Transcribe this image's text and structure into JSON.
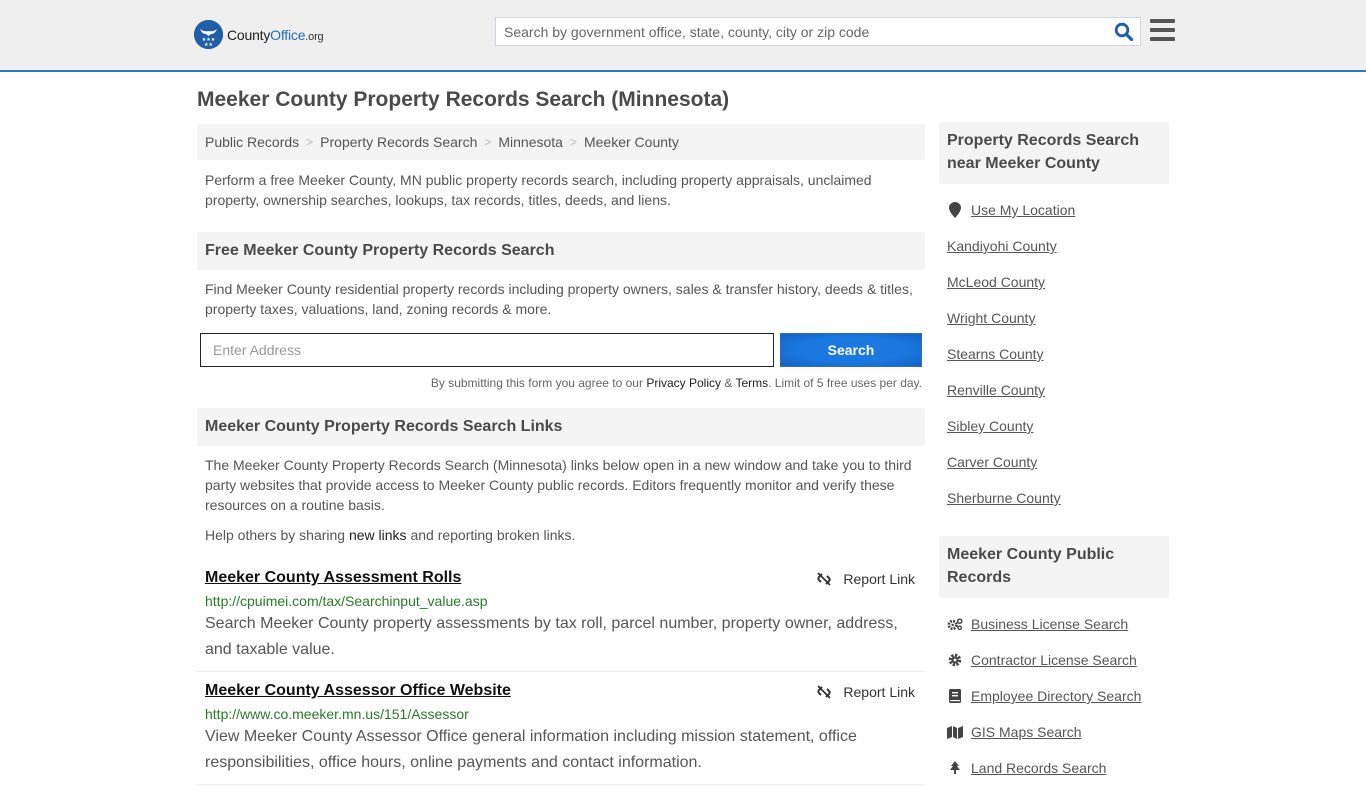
{
  "header": {
    "logo": {
      "name_part1": "County",
      "name_part2": "Office",
      "tld": ".org"
    },
    "search_placeholder": "Search by government office, state, county, city or zip code",
    "search_icon": "search-icon",
    "menu_icon": "hamburger-menu-icon",
    "accent_color": "#3079b5"
  },
  "page": {
    "title": "Meeker County Property Records Search (Minnesota)",
    "breadcrumb": [
      "Public Records",
      "Property Records Search",
      "Minnesota",
      "Meeker County"
    ],
    "intro": "Perform a free Meeker County, MN public property records search, including property appraisals, unclaimed property, ownership searches, lookups, tax records, titles, deeds, and liens."
  },
  "free_search": {
    "heading": "Free Meeker County Property Records Search",
    "description": "Find Meeker County residential property records including property owners, sales & transfer history, deeds & titles, property taxes, valuations, land, zoning records & more.",
    "address_placeholder": "Enter Address",
    "button_label": "Search",
    "button_color": "#1a6fd6",
    "disclaimer_prefix": "By submitting this form you agree to our ",
    "privacy_label": "Privacy Policy",
    "amp": " & ",
    "terms_label": "Terms",
    "disclaimer_suffix": ". Limit of 5 free uses per day."
  },
  "links_section": {
    "heading": "Meeker County Property Records Search Links",
    "description": "The Meeker County Property Records Search (Minnesota) links below open in a new window and take you to third party websites that provide access to Meeker County public records. Editors frequently monitor and verify these resources on a routine basis.",
    "help_prefix": "Help others by sharing ",
    "help_link": "new links",
    "help_suffix": " and reporting broken links.",
    "report_label": "Report Link",
    "items": [
      {
        "title": "Meeker County Assessment Rolls",
        "url": "http://cpuimei.com/tax/Searchinput_value.asp",
        "description": "Search Meeker County property assessments by tax roll, parcel number, property owner, address, and taxable value."
      },
      {
        "title": "Meeker County Assessor Office Website",
        "url": "http://www.co.meeker.mn.us/151/Assessor",
        "description": "View Meeker County Assessor Office general information including mission statement, office responsibilities, office hours, online payments and contact information."
      }
    ]
  },
  "sidebar": {
    "nearby": {
      "heading": "Property Records Search near Meeker County",
      "use_location": {
        "label": "Use My Location",
        "icon": "map-marker-icon"
      },
      "counties": [
        "Kandiyohi County",
        "McLeod County",
        "Wright County",
        "Stearns County",
        "Renville County",
        "Sibley County",
        "Carver County",
        "Sherburne County"
      ]
    },
    "public_records": {
      "heading": "Meeker County Public Records",
      "items": [
        {
          "label": "Business License Search",
          "icon": "cogs-icon"
        },
        {
          "label": "Contractor License Search",
          "icon": "gear-icon"
        },
        {
          "label": "Employee Directory Search",
          "icon": "book-icon"
        },
        {
          "label": "GIS Maps Search",
          "icon": "map-icon"
        },
        {
          "label": "Land Records Search",
          "icon": "tree-icon"
        }
      ]
    }
  }
}
